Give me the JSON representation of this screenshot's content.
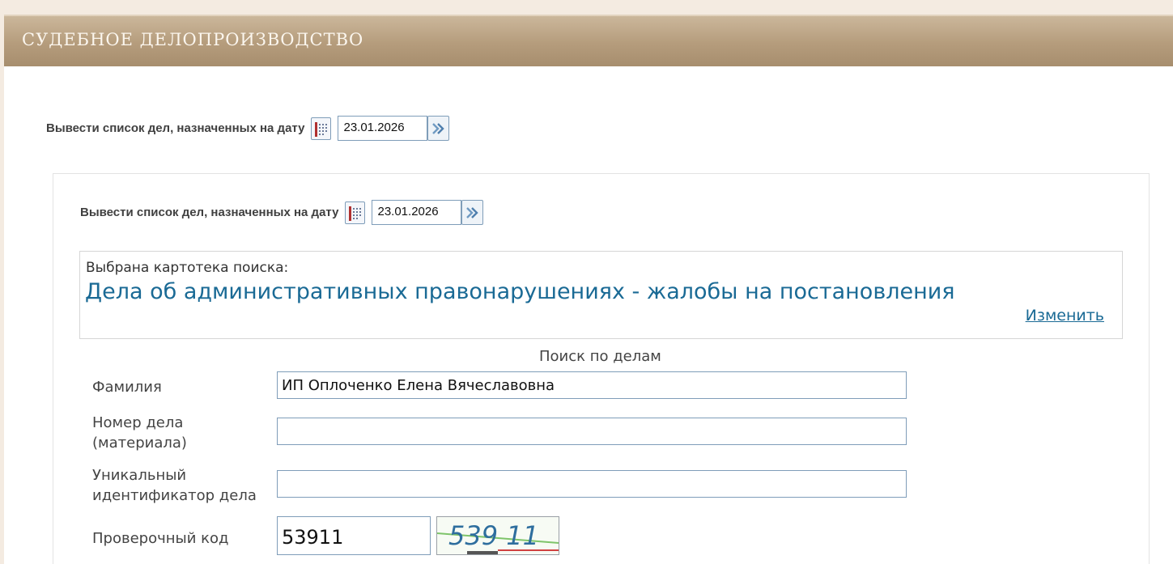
{
  "header": {
    "title": "СУДЕБНОЕ ДЕЛОПРОИЗВОДСТВО"
  },
  "date_filter_outer": {
    "label": "Вывести список дел, назначенных на дату",
    "date": "23.01.2026"
  },
  "date_filter_inner": {
    "label": "Вывести список дел, назначенных на дату",
    "date": "23.01.2026"
  },
  "card_index": {
    "label": "Выбрана картотека поиска:",
    "value": "Дела об административных правонарушениях - жалобы на постановления",
    "change_link": "Изменить"
  },
  "search": {
    "title": "Поиск по делам",
    "fields": [
      {
        "label": "Фамилия",
        "value": "ИП Оплоченко Елена Вячеславовна"
      },
      {
        "label_line1": "Номер дела",
        "label_line2": "(материала)",
        "value": ""
      },
      {
        "label_line1": "Уникальный",
        "label_line2": "идентификатор дела",
        "value": ""
      }
    ],
    "captcha": {
      "label": "Проверочный код",
      "value": "53911",
      "image_text": "539 11"
    }
  },
  "colors": {
    "header_gradient_top": "#cbb79b",
    "header_gradient_bottom": "#a78e6e",
    "link_blue": "#1a6a95",
    "input_border": "#7f9db9"
  }
}
